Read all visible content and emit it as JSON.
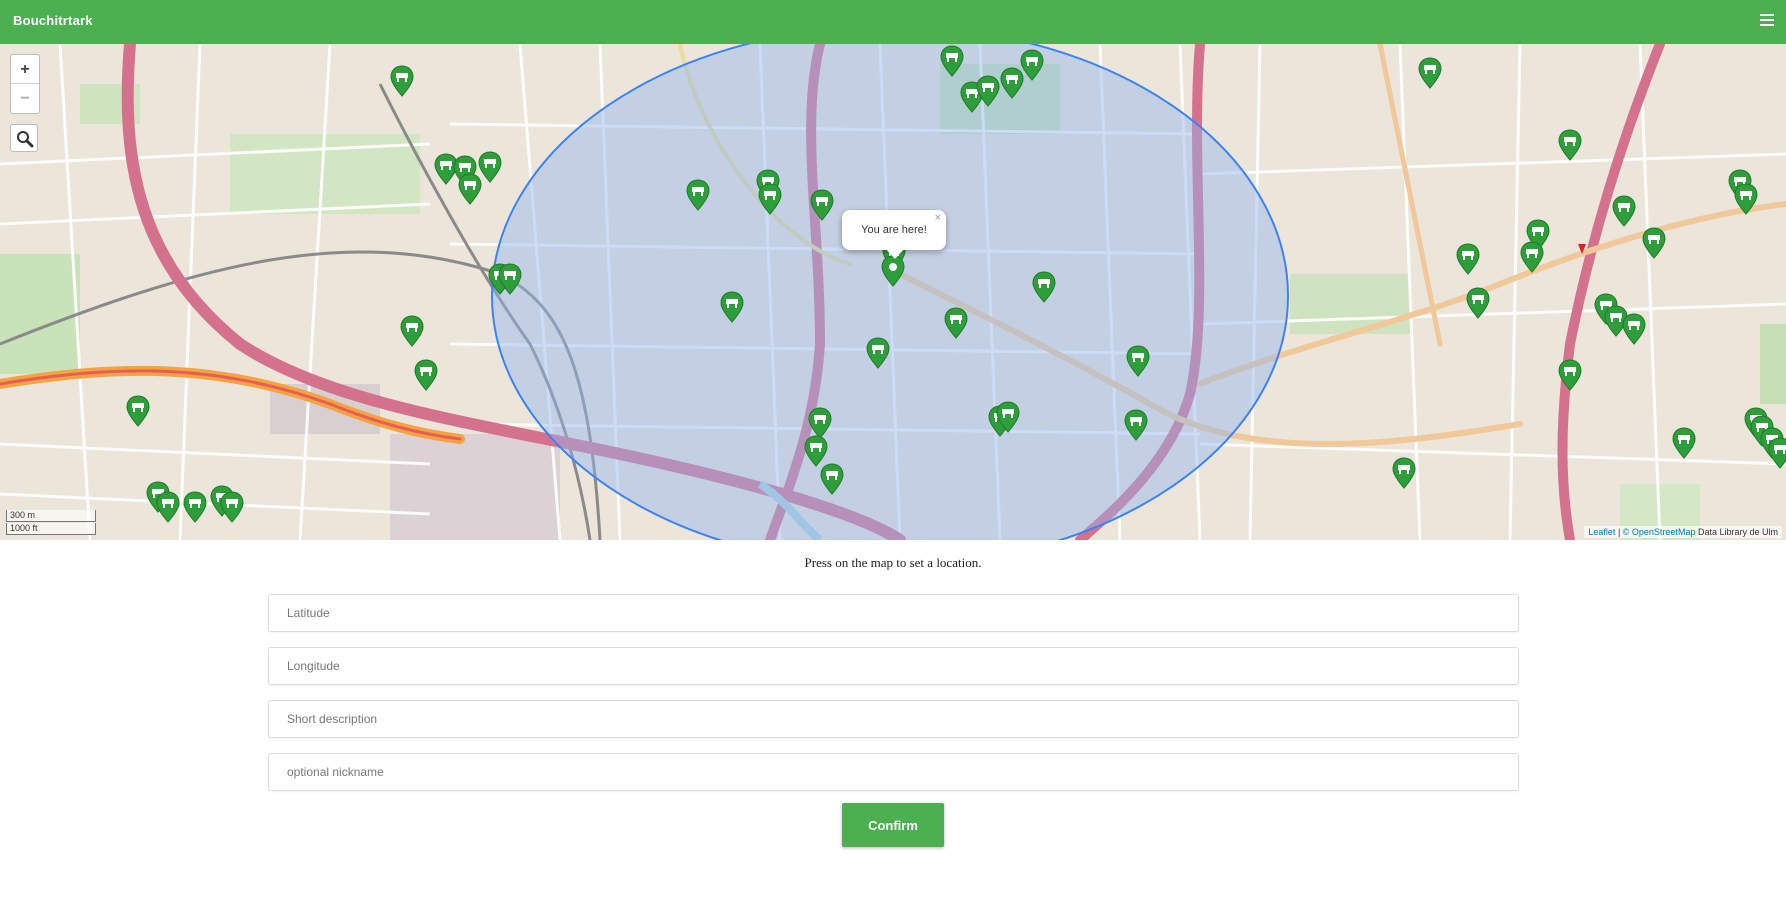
{
  "app": {
    "brand": "Bouchitrtark"
  },
  "map": {
    "zoom_in": "+",
    "zoom_out": "−",
    "scale_metric": "300 m",
    "scale_imperial": "1000 ft",
    "popup_text": "You are here!",
    "popup_close": "×",
    "attribution_leaflet": "Leaflet",
    "attribution_osm": "© OpenStreetMap",
    "attribution_tiles": "Data Library de Ulm",
    "icons": {
      "zoom": "magnifier-icon",
      "marker": "green-marker-icon",
      "menu": "hamburger-menu-icon"
    },
    "colors": {
      "accent": "#4caf50",
      "marker": "#2e9e3a",
      "circle_stroke": "#3b82f6",
      "circle_fill": "#93b6ee"
    }
  },
  "form": {
    "hint": "Press on the map to set a location.",
    "latitude_placeholder": "Latitude",
    "longitude_placeholder": "Longitude",
    "description_placeholder": "Short description",
    "nickname_placeholder": "optional nickname",
    "confirm_label": "Confirm"
  }
}
